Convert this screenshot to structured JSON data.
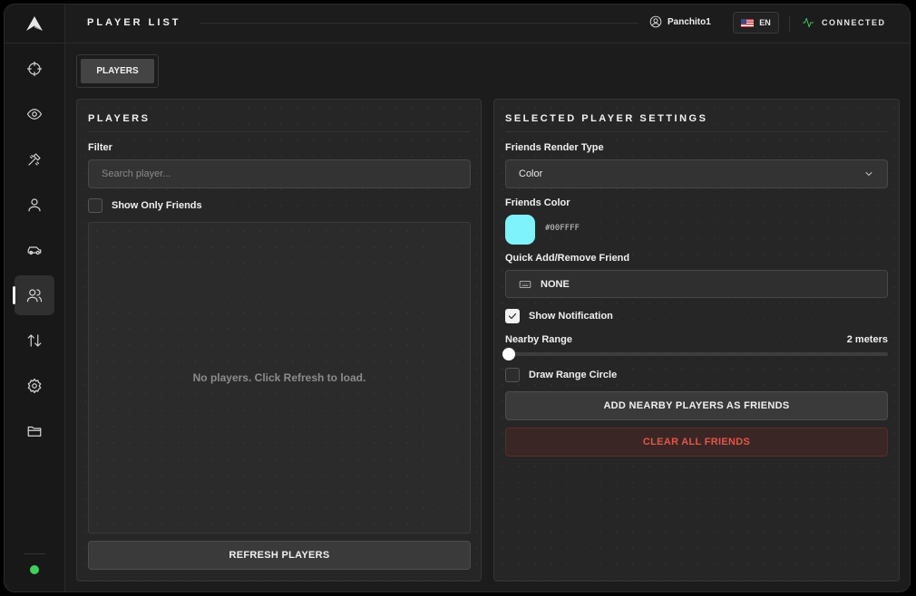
{
  "header": {
    "title": "PLAYER LIST",
    "username": "Panchito1",
    "language": "EN",
    "connection_status": "CONNECTED"
  },
  "sidebar": {
    "items": [
      {
        "name": "crosshair",
        "icon": "crosshair-icon"
      },
      {
        "name": "visuals",
        "icon": "eye-icon"
      },
      {
        "name": "weapons",
        "icon": "tools-icon"
      },
      {
        "name": "player",
        "icon": "user-icon"
      },
      {
        "name": "vehicle",
        "icon": "car-icon"
      },
      {
        "name": "players",
        "icon": "users-icon",
        "active": true
      },
      {
        "name": "transfer",
        "icon": "arrows-icon"
      },
      {
        "name": "settings",
        "icon": "gear-icon"
      },
      {
        "name": "files",
        "icon": "folder-icon"
      }
    ],
    "status_color": "#3ecf5e"
  },
  "tabs": [
    {
      "label": "PLAYERS"
    }
  ],
  "players_panel": {
    "title": "PLAYERS",
    "filter_label": "Filter",
    "search_placeholder": "Search player...",
    "show_only_friends_label": "Show Only Friends",
    "show_only_friends": false,
    "empty_message": "No players. Click Refresh to load.",
    "refresh_button": "REFRESH PLAYERS"
  },
  "settings_panel": {
    "title": "SELECTED PLAYER SETTINGS",
    "render_type_label": "Friends Render Type",
    "render_type_value": "Color",
    "color_label": "Friends Color",
    "color_value": "#00FFFF",
    "color_display": "#7ef3fb",
    "quick_add_label": "Quick Add/Remove Friend",
    "quick_add_key": "NONE",
    "show_notification_label": "Show Notification",
    "show_notification": true,
    "nearby_range_label": "Nearby Range",
    "nearby_range_value": "2 meters",
    "nearby_range_fraction": 0.0,
    "draw_range_circle_label": "Draw Range Circle",
    "draw_range_circle": false,
    "add_nearby_button": "ADD NEARBY PLAYERS AS FRIENDS",
    "clear_button": "CLEAR ALL FRIENDS"
  }
}
